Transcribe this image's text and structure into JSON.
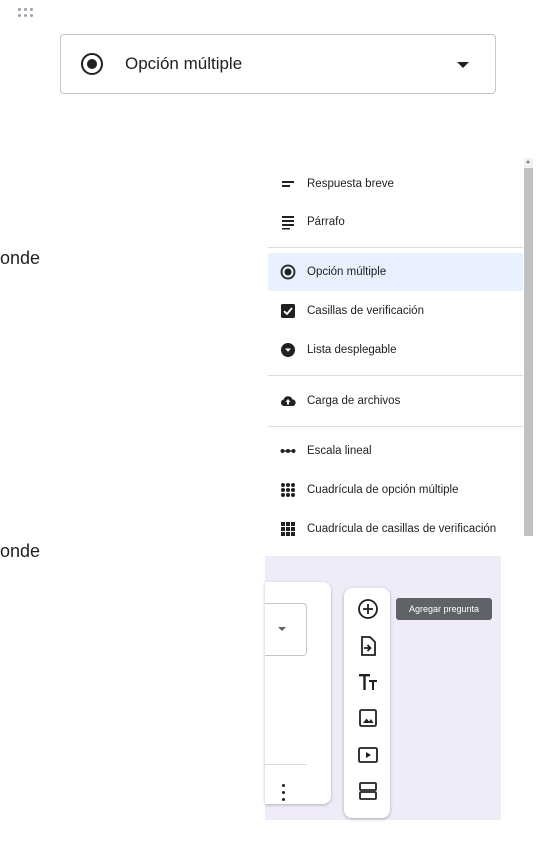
{
  "question_type": {
    "selected_label": "Opción múltiple"
  },
  "fragments": {
    "top": "onde",
    "bottom": "onde"
  },
  "menu": {
    "items": [
      {
        "label": "Respuesta breve",
        "icon": "short-answer-icon"
      },
      {
        "label": "Párrafo",
        "icon": "paragraph-icon"
      },
      {
        "label": "Opción múltiple",
        "icon": "radio-button-icon",
        "selected": true
      },
      {
        "label": "Casillas de verificación",
        "icon": "checkbox-icon"
      },
      {
        "label": "Lista desplegable",
        "icon": "dropdown-icon"
      },
      {
        "label": "Carga de archivos",
        "icon": "cloud-upload-icon"
      },
      {
        "label": "Escala lineal",
        "icon": "linear-scale-icon"
      },
      {
        "label": "Cuadrícula de opción múltiple",
        "icon": "dot-grid-icon"
      },
      {
        "label": "Cuadrícula de casillas de verificación",
        "icon": "checkbox-grid-icon"
      }
    ]
  },
  "toolbar": {
    "tooltip": "Agregar pregunta",
    "buttons": [
      "add-question-icon",
      "import-questions-icon",
      "title-text-icon",
      "image-icon",
      "video-icon",
      "section-icon"
    ]
  },
  "colors": {
    "selected_bg": "#e8f0fe",
    "panel_bg": "#f0ebf8",
    "tooltip_bg": "#5f6368"
  }
}
